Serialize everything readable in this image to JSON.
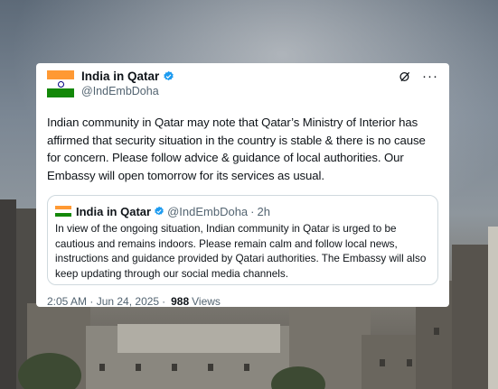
{
  "tweet": {
    "author_name": "India in Qatar",
    "handle": "@IndEmbDoha",
    "text": "Indian community in Qatar may note that Qatar’s Ministry of Interior has affirmed that security situation in the country is stable & there is no cause for concern. Please follow advice & guidance of local authorities. Our Embassy will open tomorrow for its services as usual.",
    "time": "2:05 AM · Jun 24, 2025",
    "separator": "·",
    "views_count": "988",
    "views_label": "Views",
    "more_icon": "···"
  },
  "quoted": {
    "author_name": "India in Qatar",
    "handle": "@IndEmbDoha",
    "dot": "·",
    "time": "2h",
    "text": "In view of the ongoing situation, Indian community in Qatar is urged to be cautious and remains indoors. Please remain calm and follow local news, instructions and guidance provided by Qatari authorities. The Embassy will also keep updating through our social media channels."
  },
  "colors": {
    "verified": "#1d9bf0",
    "saffron": "#ff9933",
    "green": "#138808",
    "text": "#0f1419",
    "secondary": "#536471"
  },
  "icons": [
    "india-flag-icon",
    "verified-badge-icon",
    "grok-icon",
    "more-icon"
  ]
}
